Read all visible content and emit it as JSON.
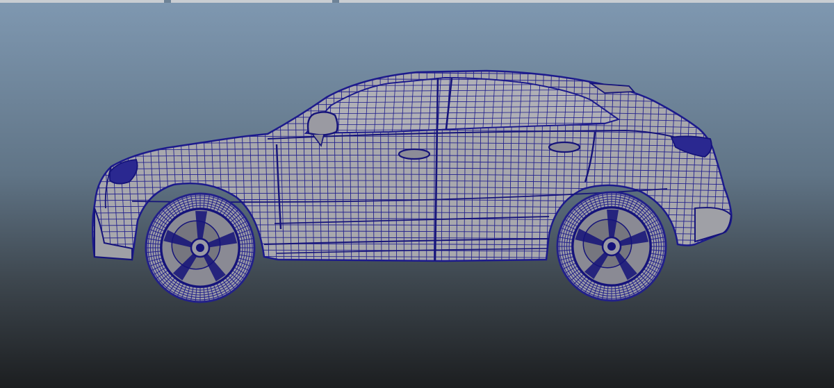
{
  "viewport": {
    "background_top": "#7f98b1",
    "background_bottom": "#1c1e20",
    "view": "side-orthographic"
  },
  "model": {
    "name": "car-wireframe",
    "display_mode": "wireframe-on-shaded",
    "shaded_color": "#a8a8ad",
    "wire_color": "#1c1a8c",
    "tire_color": "#22208a",
    "rim_color": "#15137a"
  }
}
